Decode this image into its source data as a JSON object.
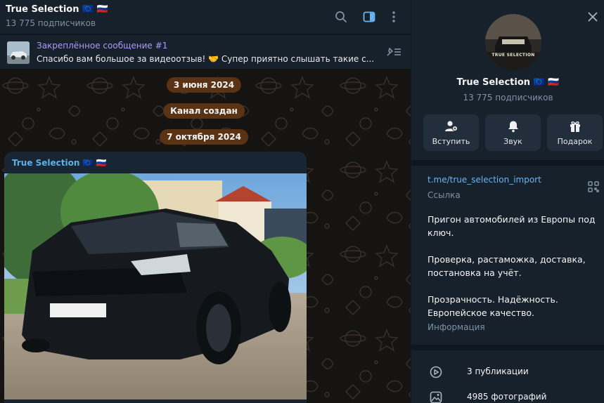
{
  "chat": {
    "title": "True Selection 🇪🇺 🇷🇺",
    "subscribers": "13 775 подписчиков"
  },
  "pinned": {
    "title": "Закреплённое сообщение #1",
    "text": "Спасибо вам большое за видеоотзыв! 🤝 Супер приятно слышать такие с..."
  },
  "timeline": {
    "date1": "3 июня 2024",
    "created": "Канал создан",
    "date2": "7 октября 2024"
  },
  "message": {
    "author": "True Selection 🇪🇺 🇷🇺"
  },
  "profile": {
    "logo_text": "TRUE SELECTION",
    "name": "True Selection 🇪🇺 🇷🇺",
    "subscribers": "13 775 подписчиков",
    "actions": [
      {
        "label": "Вступить",
        "icon": "person-add-icon"
      },
      {
        "label": "Звук",
        "icon": "bell-icon"
      },
      {
        "label": "Подарок",
        "icon": "gift-icon"
      }
    ],
    "link": "t.me/true_selection_import",
    "link_caption": "Ссылка",
    "about": [
      "Пригон автомобилей из Европы под ключ.",
      "Проверка, растаможка, доставка, постановка на учёт.",
      "Прозрачность. Надёжность. Европейское качество."
    ],
    "about_caption": "Информация",
    "stats": [
      {
        "label": "3 публикации",
        "icon": "video-icon"
      },
      {
        "label": "4985 фотографий",
        "icon": "photo-icon"
      }
    ]
  },
  "colors": {
    "accent": "#6ab3f3",
    "date_pill": "#5a3214",
    "panel": "#17212b"
  }
}
